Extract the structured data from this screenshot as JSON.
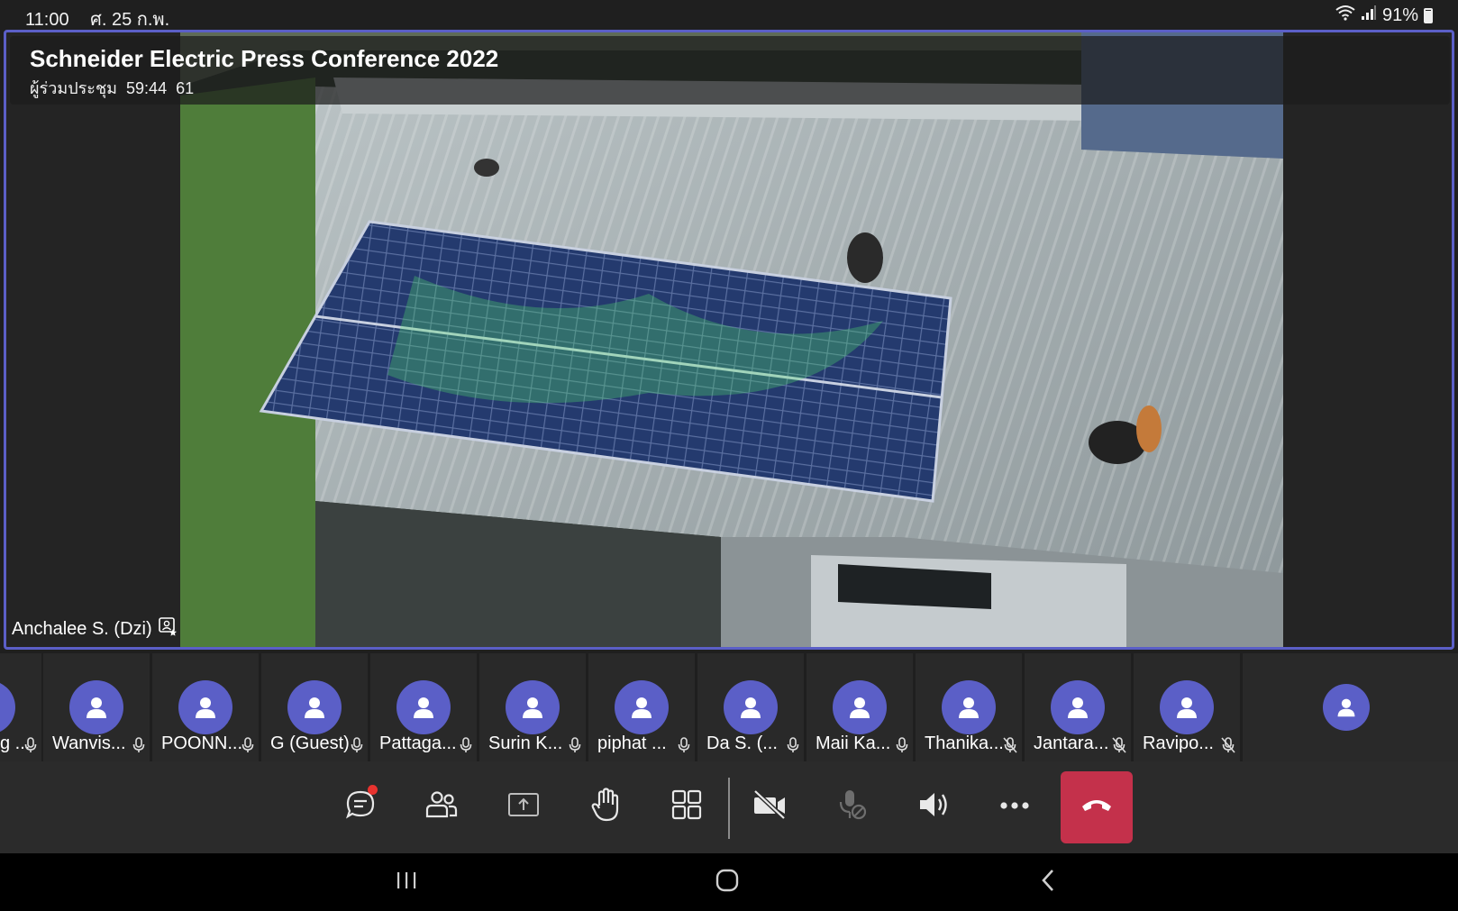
{
  "status_bar": {
    "time": "11:00",
    "date": "ศ. 25 ก.พ.",
    "battery": "91%"
  },
  "meeting": {
    "title": "Schneider Electric Press Conference 2022",
    "participants_label": "ผู้ร่วมประชุม",
    "duration": "59:44",
    "participant_count": "61",
    "presenter": "Anchalee S. (Dzi)"
  },
  "participants": [
    {
      "name": "g ...",
      "mic": "on"
    },
    {
      "name": "Wanvis...",
      "mic": "on"
    },
    {
      "name": "POONN...",
      "mic": "on"
    },
    {
      "name": "G (Guest)",
      "mic": "on"
    },
    {
      "name": "Pattaga...",
      "mic": "on"
    },
    {
      "name": "Surin K...",
      "mic": "on"
    },
    {
      "name": "piphat ...",
      "mic": "on"
    },
    {
      "name": "Da S. (...",
      "mic": "on"
    },
    {
      "name": "Maii Ka...",
      "mic": "on"
    },
    {
      "name": "Thanika...",
      "mic": "muted"
    },
    {
      "name": "Jantara...",
      "mic": "muted"
    },
    {
      "name": "Ravipo...",
      "mic": "muted"
    },
    {
      "name": "",
      "mic": "none"
    }
  ],
  "controls": [
    {
      "name": "chat-button",
      "icon": "chat-icon"
    },
    {
      "name": "people-button",
      "icon": "people-icon"
    },
    {
      "name": "share-button",
      "icon": "share-screen-icon"
    },
    {
      "name": "raise-hand-button",
      "icon": "hand-icon"
    },
    {
      "name": "layout-button",
      "icon": "grid-icon"
    },
    {
      "name": "camera-button",
      "icon": "camera-off-icon"
    },
    {
      "name": "mic-button",
      "icon": "mic-disabled-icon"
    },
    {
      "name": "speaker-button",
      "icon": "speaker-icon"
    },
    {
      "name": "more-button",
      "icon": "more-icon"
    },
    {
      "name": "hangup-button",
      "icon": "hangup-icon"
    }
  ],
  "colors": {
    "accent": "#5b5fc7",
    "hangup": "#c4314b",
    "notification": "#e8332f"
  }
}
